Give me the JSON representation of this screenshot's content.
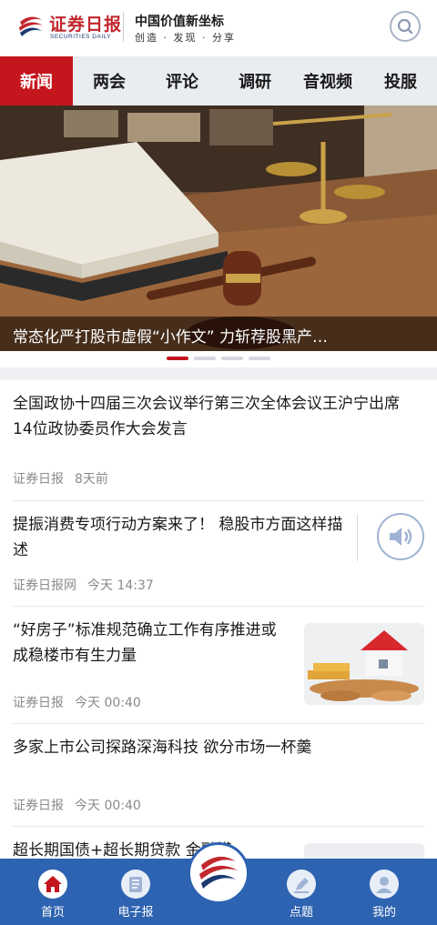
{
  "header": {
    "logo_cn": "证券日报",
    "logo_en": "SECURITIES DAILY",
    "slogan": "中国价值新坐标",
    "slogan_sub": "创造 · 发现 · 分享"
  },
  "tabs": [
    {
      "label": "新闻",
      "active": true
    },
    {
      "label": "两会"
    },
    {
      "label": "评论"
    },
    {
      "label": "调研"
    },
    {
      "label": "音视频"
    },
    {
      "label": "投服"
    }
  ],
  "banner": {
    "caption": "常态化严打股市虚假“小作文” 力斩荐股黑产…",
    "slide_count": 4,
    "active_slide": 1
  },
  "news": [
    {
      "title": "全国政协十四届三次会议举行第三次全体会议王沪宁出席 14位政协委员作大会发言",
      "source": "证券日报",
      "time": "8天前"
    },
    {
      "title": "提振消费专项行动方案来了！ 稳股市方面这样描述",
      "source": "证券日报网",
      "time": "今天 14:37",
      "audio_icon": "speaker-icon"
    },
    {
      "title": "“好房子”标准规范确立工作有序推进或成稳楼市有生力量",
      "source": "证券日报",
      "time": "今天 00:40",
      "thumbnail": "house-coins-image"
    },
    {
      "title": "多家上市公司探路深海科技 欲分市场一杯羹",
      "source": "证券日报",
      "time": "今天 00:40"
    },
    {
      "title": "超长期国债+超长期贷款 金融模"
    }
  ],
  "bottom_nav": [
    {
      "label": "首页",
      "icon": "home-icon",
      "active": true
    },
    {
      "label": "电子报",
      "icon": "newspaper-icon"
    },
    {
      "label": "",
      "icon": "brand-logo-icon"
    },
    {
      "label": "点题",
      "icon": "pen-icon"
    },
    {
      "label": "我的",
      "icon": "user-icon"
    }
  ],
  "colors": {
    "brand_red": "#c4161c",
    "nav_blue": "#2d63b1",
    "tab_bg": "#e9ecf1"
  }
}
